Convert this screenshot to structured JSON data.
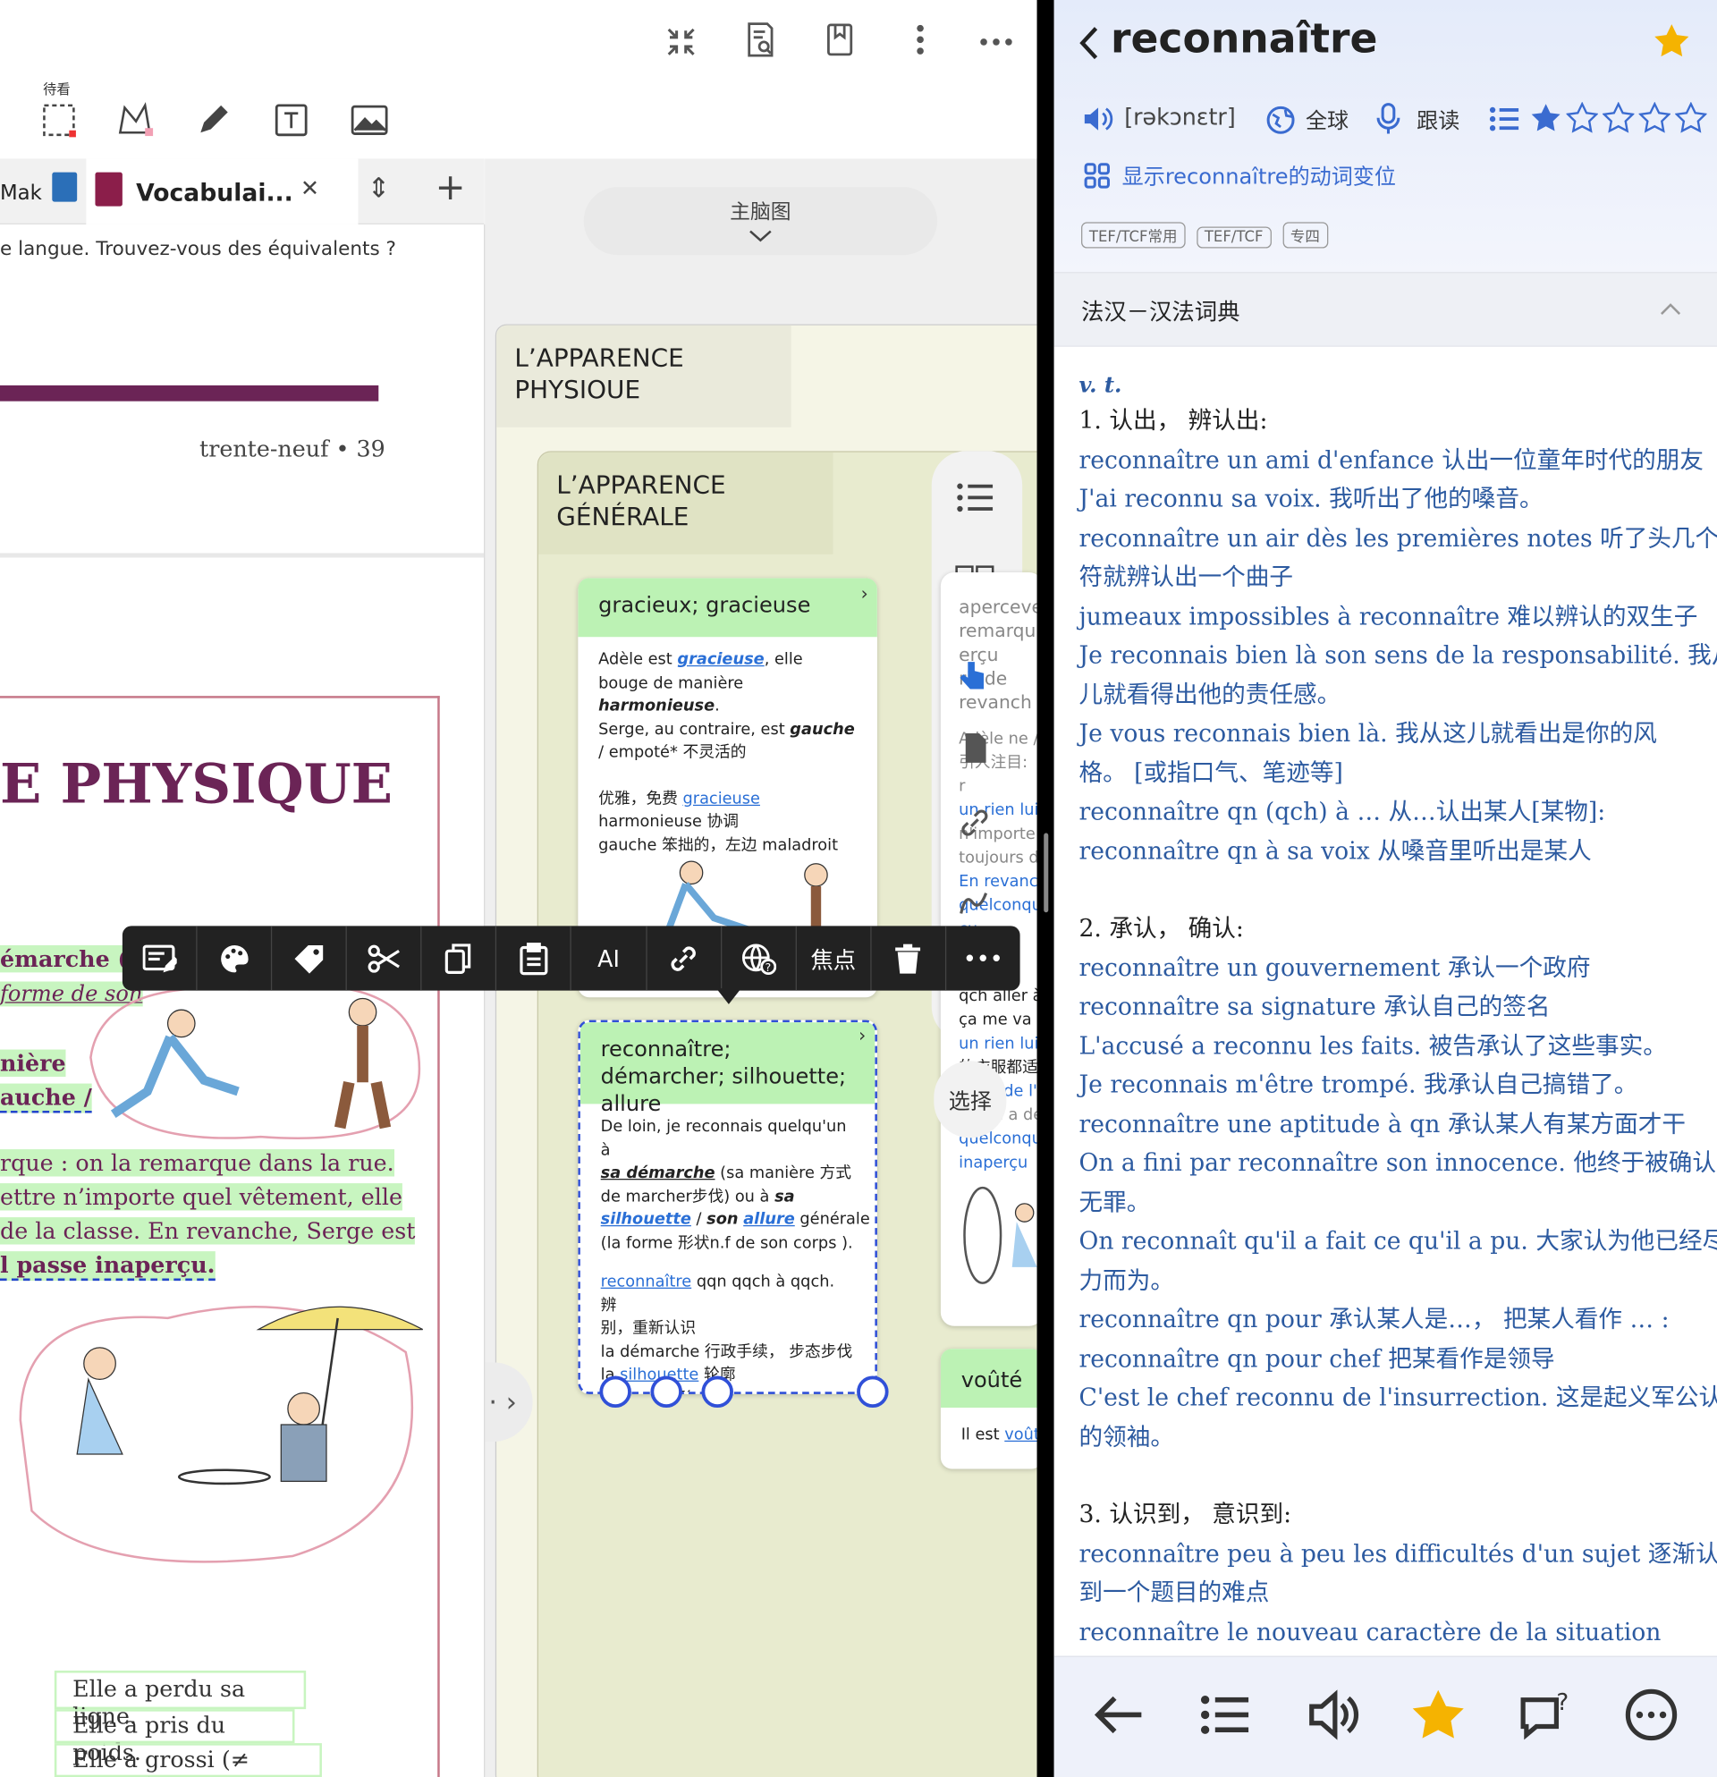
{
  "toolbar": {
    "tool_label": "待看",
    "icons": [
      "collapse-icon",
      "search-document-icon",
      "bookmark-icon",
      "vertical-dots-icon",
      "more-dots-icon"
    ],
    "tools": [
      "rect-select-icon",
      "lasso-icon",
      "pen-icon",
      "text-box-icon",
      "image-icon"
    ]
  },
  "tabs": {
    "truncated_tab": "Mak",
    "active_tab": "Vocabulai...",
    "close": "✕",
    "sort": "⇕",
    "add": "+"
  },
  "pdf": {
    "intro": "e langue. Trouvez-vous des équivalents ?",
    "page_number": "trente-neuf • 39",
    "heading": "E PHYSIQUE",
    "lines": [
      {
        "text": "émarche (sa manière de marcher) o"
      },
      {
        "text": "forme de son"
      },
      {
        "text": "nière"
      },
      {
        "text": "auche /"
      },
      {
        "text": "rque : on la remarque dans la rue."
      },
      {
        "text": "ettre n’importe quel vêtement, elle"
      },
      {
        "text": "de la classe. En revanche, Serge est"
      },
      {
        "text": "l passe inaperçu."
      }
    ],
    "exercise": [
      "Elle a perdu sa ligne.",
      "Elle a pris du poids.",
      "Elle a grossi (≠ maigri)."
    ]
  },
  "mindmap": {
    "main_btn": "主脑图",
    "root": "L’APPARENCE PHYSIOUE",
    "branch": "L’APPARENCE GÉNÉRALE",
    "card1": {
      "title": "gracieux; gracieuse",
      "p1a": "Adèle est ",
      "p1b": "gracieuse",
      "p1c": ", elle bouge de manière ",
      "p1d": "harmonieuse",
      "p1e": ".",
      "p2a": "Serge, au contraire, est ",
      "p2b": "gauche",
      "p2c": " / empoté* 不灵活的",
      "g1a": "优雅，免费 ",
      "g1b": "gracieuse",
      "g2": "harmonieuse 协调",
      "g3": "gauche 笨拙的，左边 maladroit"
    },
    "card2": {
      "title": "reconnaître; démarcher; silhouette; allure",
      "p1": "De loin, je reconnais quelqu'un à",
      "p2a": "sa démarche",
      "p2b": " (sa manière 方式",
      "p3a": "de marcher步伐) ou à ",
      "p3b": "sa",
      "p4a": "silhouette",
      "p4b": " / ",
      "p4c": "son",
      "p4d": " ",
      "p4e": "allure",
      "p4f": " générale",
      "p5": "(la forme 形状n.f  de son corps ).",
      "g1a": "reconnaître",
      "g1b": " qqn qqch à qqch. 辨",
      "g2": "别，重新认识",
      "g3": "la démarche 行政手续， 步态步伐",
      "g4a": "la ",
      "g4b": "silhouette",
      "g4c": " 轮廓",
      "g5a": "l’",
      "g5b": "allure",
      "g5c": " 外形"
    },
    "side_card": {
      "lines": [
        "aperceve",
        "remarqu",
        "erçu",
        "rir de",
        "revanch",
        "Adèle ne /",
        "引人注目:",
        "r",
        "un rien lui",
        "n'importe",
        "toujours d",
        "En revanc",
        "quelconqu",
        "çu.",
        "qch aller à",
        "ça me va",
        "un rien lui",
        "的衣服都适",
        "avoir de l'a",
        "（Elle a de la class",
        "quelconqu",
        "inaperçu"
      ]
    },
    "select_label": "选择",
    "voute_title": "voûté",
    "voute_body_a": "Il est ",
    "voute_body_b": "voûté",
    "nav_label": "‹ · ›"
  },
  "context_menu": {
    "items": [
      {
        "name": "edit-note-icon",
        "label": ""
      },
      {
        "name": "palette-icon",
        "label": ""
      },
      {
        "name": "tag-icon",
        "label": ""
      },
      {
        "name": "scissors-icon",
        "label": ""
      },
      {
        "name": "copy-icon",
        "label": ""
      },
      {
        "name": "paste-icon",
        "label": ""
      },
      {
        "name": "ai-button",
        "label": "AI"
      },
      {
        "name": "link-icon",
        "label": ""
      },
      {
        "name": "web-search-icon",
        "label": ""
      },
      {
        "name": "focus-button",
        "label": "焦点"
      },
      {
        "name": "trash-icon",
        "label": ""
      },
      {
        "name": "more-icon",
        "label": "•••"
      }
    ]
  },
  "dictionary": {
    "word": "reconnaître",
    "phonetic": "[rəkɔnɛtr]",
    "region": "全球",
    "follow": "跟读",
    "conjugation": "显示reconnaître的动词变位",
    "tags": [
      "TEF/TCF常用",
      "TEF/TCF",
      "专四"
    ],
    "section": "法汉－汉法词典",
    "pos": "v. t.",
    "rating": 1,
    "senses": [
      {
        "head": "1. 认出， 辨认出:",
        "lines": [
          "reconnaître un ami d'enfance 认出一位童年时代的朋友",
          "J'ai reconnu sa voix. 我听出了他的嗓音。",
          "reconnaître un air dès les premières notes 听了头几个音",
          "符就辨认出一个曲子",
          "jumeaux impossibles à reconnaître 难以辨认的双生子",
          "Je reconnais bien là son sens de la responsabilité. 我从这",
          "儿就看得出他的责任感。",
          "Je vous reconnais bien là. 我从这儿就看出是你的风",
          "格。 [或指口气、笔迹等]",
          "reconnaître qn (qch) à … 从…认出某人[某物]:",
          "reconnaître qn à sa voix 从嗓音里听出是某人"
        ]
      },
      {
        "head": "2. 承认， 确认:",
        "lines": [
          "reconnaître un gouvernement 承认一个政府",
          "reconnaître sa signature 承认自己的签名",
          "L'accusé a reconnu les faits. 被告承认了这些事实。",
          "Je reconnais m'être trompé. 我承认自己搞错了。",
          "reconnaître une aptitude à qn 承认某人有某方面才干",
          "On a fini par reconnaître son innocence. 他终于被确认",
          "无罪。",
          "On reconnaît qu'il a fait ce qu'il a pu. 大家认为他已经尽",
          "力而为。",
          "reconnaître qn pour 承认某人是…， 把某人看作 … :",
          "reconnaître qn pour chef 把某看作是领导",
          "C'est le chef reconnu de l'insurrection. 这是起义军公认",
          "的领袖。"
        ]
      },
      {
        "head": "3. 认识到， 意识到:",
        "lines": [
          "reconnaître peu à peu les difficultés d'un sujet 逐渐认识",
          "到一个题目的难点",
          "reconnaître le nouveau caractère de la situation"
        ]
      }
    ],
    "footer": [
      "back-arrow-icon",
      "list-icon",
      "speaker-icon",
      "star-icon",
      "question-card-icon",
      "more-circle-icon"
    ]
  },
  "colors": {
    "accent": "#2c5aa0",
    "card_header": "#bcf2b4",
    "dict_bg": "#e4ebfa",
    "star": "#f5b301"
  }
}
